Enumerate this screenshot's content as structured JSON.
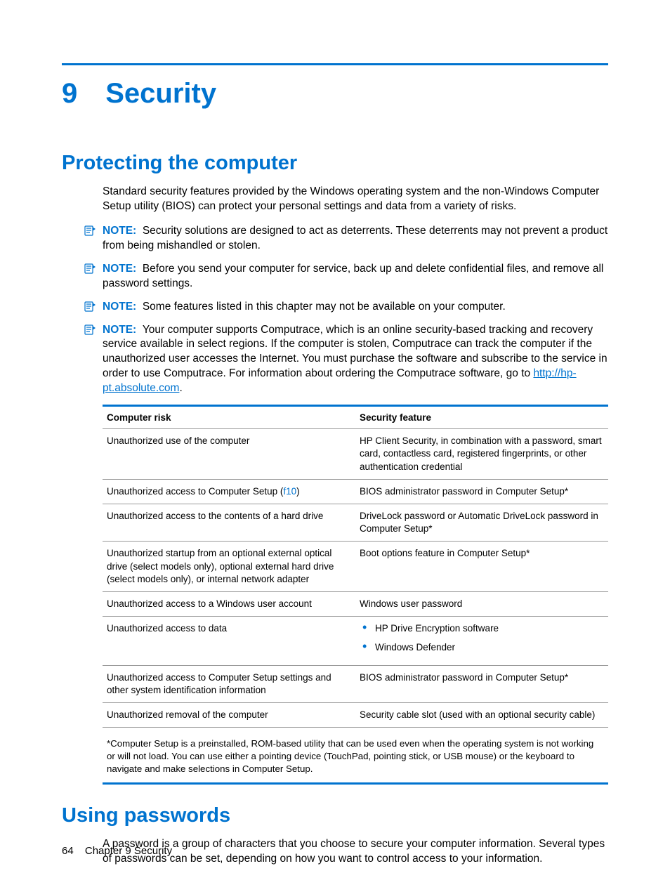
{
  "chapter": {
    "number": "9",
    "title": "Security"
  },
  "section1": {
    "heading": "Protecting the computer",
    "intro": "Standard security features provided by the Windows operating system and the non-Windows Computer Setup utility (BIOS) can protect your personal settings and data from a variety of risks."
  },
  "notes": {
    "label": "NOTE:",
    "n1": "Security solutions are designed to act as deterrents. These deterrents may not prevent a product from being mishandled or stolen.",
    "n2": "Before you send your computer for service, back up and delete confidential files, and remove all password settings.",
    "n3": "Some features listed in this chapter may not be available on your computer.",
    "n4_a": "Your computer supports Computrace, which is an online security-based tracking and recovery service available in select regions. If the computer is stolen, Computrace can track the computer if the unauthorized user accesses the Internet. You must purchase the software and subscribe to the service in order to use Computrace. For information about ordering the Computrace software, go to ",
    "n4_link": "http://hp-pt.absolute.com",
    "n4_b": "."
  },
  "table": {
    "h1": "Computer risk",
    "h2": "Security feature",
    "rows": [
      {
        "risk": "Unauthorized use of the computer",
        "feature": "HP Client Security, in combination with a password, smart card, contactless card, registered fingerprints, or other authentication credential"
      },
      {
        "risk_a": "Unauthorized access to Computer Setup (",
        "risk_key": "f10",
        "risk_b": ")",
        "feature": "BIOS administrator password in Computer Setup*"
      },
      {
        "risk": "Unauthorized access to the contents of a hard drive",
        "feature": "DriveLock password or Automatic DriveLock password in Computer Setup*"
      },
      {
        "risk": "Unauthorized startup from an optional external optical drive (select models only), optional external hard drive (select models only), or internal network adapter",
        "feature": "Boot options feature in Computer Setup*"
      },
      {
        "risk": "Unauthorized access to a Windows user account",
        "feature": "Windows user password"
      },
      {
        "risk": "Unauthorized access to data",
        "list": [
          "HP Drive Encryption software",
          "Windows Defender"
        ]
      },
      {
        "risk": "Unauthorized access to Computer Setup settings and other system identification information",
        "feature": "BIOS administrator password in Computer Setup*"
      },
      {
        "risk": "Unauthorized removal of the computer",
        "feature": "Security cable slot (used with an optional security cable)"
      }
    ],
    "footnote": "*Computer Setup is a preinstalled, ROM-based utility that can be used even when the operating system is not working or will not load. You can use either a pointing device (TouchPad, pointing stick, or USB mouse) or the keyboard to navigate and make selections in Computer Setup."
  },
  "section2": {
    "heading": "Using passwords",
    "intro": "A password is a group of characters that you choose to secure your computer information. Several types of passwords can be set, depending on how you want to control access to your information."
  },
  "footer": {
    "page": "64",
    "text": "Chapter 9   Security"
  }
}
